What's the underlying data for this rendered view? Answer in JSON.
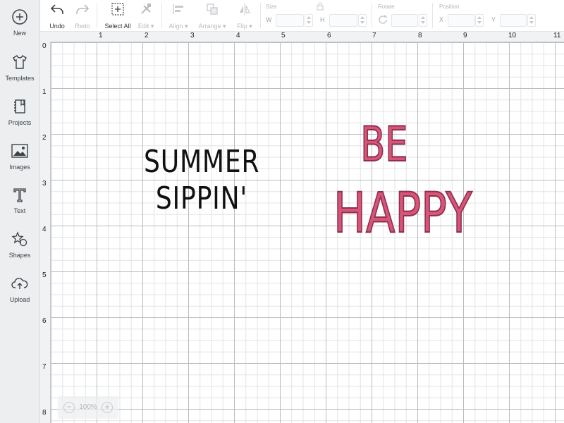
{
  "sidebar": {
    "items": [
      {
        "label": "New",
        "icon": "plus-circle-icon"
      },
      {
        "label": "Templates",
        "icon": "tshirt-icon"
      },
      {
        "label": "Projects",
        "icon": "notebook-icon"
      },
      {
        "label": "Images",
        "icon": "image-icon"
      },
      {
        "label": "Text",
        "icon": "text-t-icon"
      },
      {
        "label": "Shapes",
        "icon": "shapes-icon"
      },
      {
        "label": "Upload",
        "icon": "cloud-upload-icon"
      }
    ]
  },
  "toolbar": {
    "undo": "Undo",
    "redo": "Redo",
    "select_all": "Select All",
    "edit": "Edit",
    "align": "Align",
    "arrange": "Arrange",
    "flip": "Flip",
    "size_label": "Size",
    "w_label": "W",
    "h_label": "H",
    "rotate_label": "Rotate",
    "position_label": "Position",
    "x_label": "X",
    "y_label": "Y"
  },
  "ruler": {
    "top": [
      "1",
      "2",
      "3",
      "4",
      "5",
      "6",
      "7",
      "8",
      "9",
      "10",
      "11"
    ],
    "left": [
      "0",
      "1",
      "2",
      "3",
      "4",
      "5",
      "6",
      "7",
      "8"
    ]
  },
  "canvas": {
    "text1_line1": "SUMMER",
    "text1_line2": "SIPPIN'",
    "text2_line1": "BE",
    "text2_line2": "HAPPY"
  },
  "colors": {
    "text1": "#111111",
    "text2_fill": "#d8557a",
    "text2_outline": "#8e2f4c"
  },
  "zoom": {
    "value": "100%",
    "minus": "−",
    "plus": "+"
  }
}
